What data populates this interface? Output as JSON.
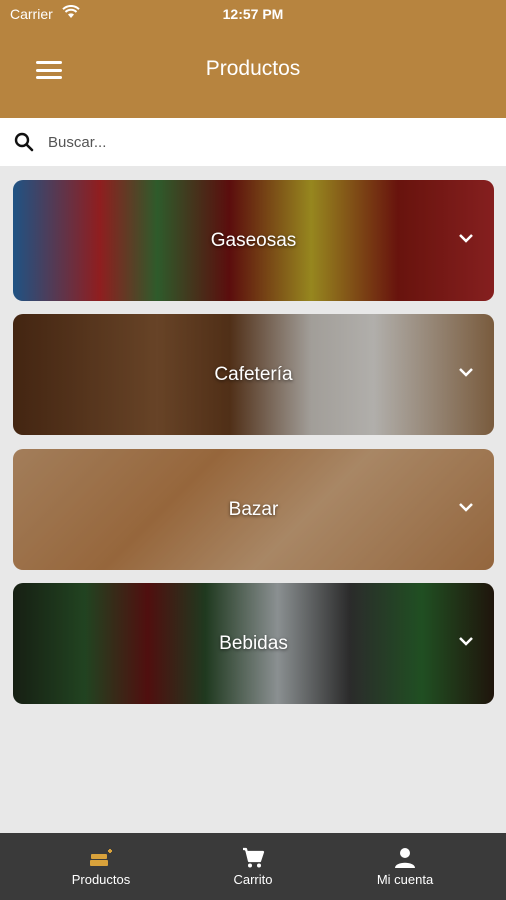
{
  "status_bar": {
    "carrier": "Carrier",
    "time": "12:57 PM"
  },
  "header": {
    "title": "Productos"
  },
  "search": {
    "placeholder": "Buscar..."
  },
  "categories": [
    {
      "label": "Gaseosas"
    },
    {
      "label": "Cafetería"
    },
    {
      "label": "Bazar"
    },
    {
      "label": "Bebidas"
    }
  ],
  "bottom_nav": {
    "items": [
      {
        "label": "Productos",
        "icon": "products-icon"
      },
      {
        "label": "Carrito",
        "icon": "cart-icon"
      },
      {
        "label": "Mi cuenta",
        "icon": "account-icon"
      }
    ]
  },
  "colors": {
    "header": "#b7843f",
    "active_nav": "#d9a23b",
    "nav_bg": "#3a3a3a"
  }
}
